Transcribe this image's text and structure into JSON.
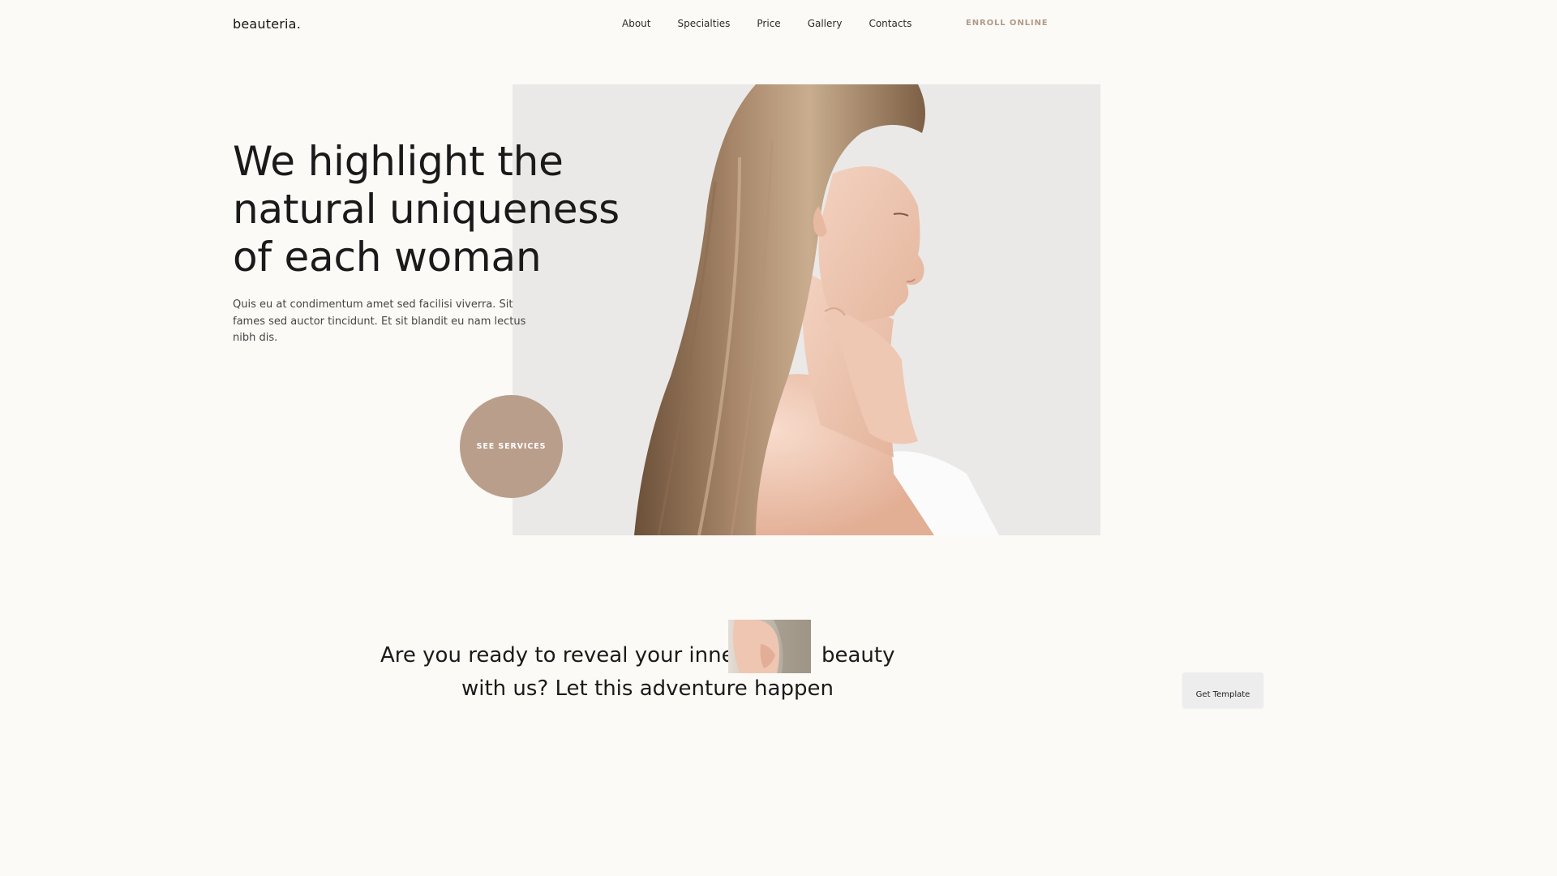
{
  "header": {
    "logo": "beauteria.",
    "nav": [
      {
        "label": "About"
      },
      {
        "label": "Specialties"
      },
      {
        "label": "Price"
      },
      {
        "label": "Gallery"
      },
      {
        "label": "Contacts"
      }
    ],
    "enroll_label": "ENROLL ONLINE"
  },
  "hero": {
    "title": "We highlight the natural uniqueness of each woman",
    "subtitle": "Quis eu at condimentum amet sed facilisi viverra. Sit fames sed auctor tincidunt. Et sit blandit eu nam lectus nibh dis.",
    "cta_label": "SEE SERVICES"
  },
  "tagline": {
    "part1": "Are you ready to reveal your inner",
    "part2": "beauty",
    "line2": "with us? Let this adventure happen"
  },
  "badge": {
    "label": "Get Template"
  },
  "colors": {
    "background": "#fcfaf6",
    "accent": "#b99e8b",
    "enroll_text": "#b09a89",
    "text_dark": "#1a1a1a"
  }
}
